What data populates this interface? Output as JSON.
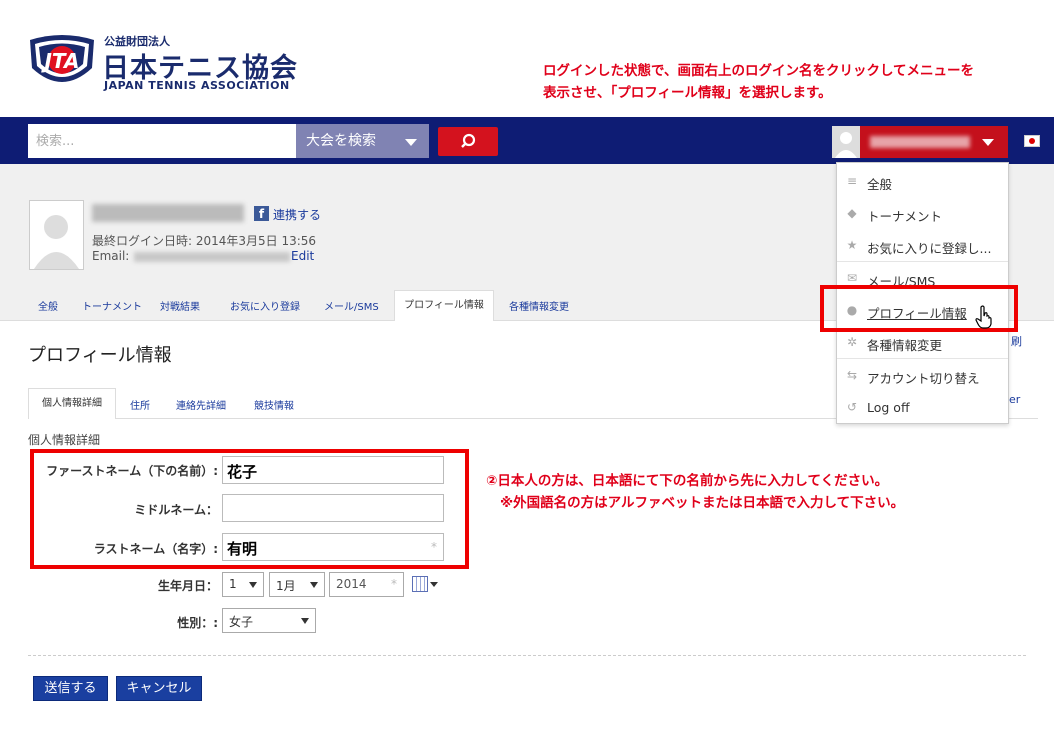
{
  "logo": {
    "emblem_text": "JTA",
    "subtitle": "公益財団法人",
    "main": "日本テニス協会",
    "english": "JAPAN TENNIS ASSOCIATION"
  },
  "instructions": {
    "note1_line1": "ログインした状態で、画面右上のログイン名をクリックしてメニューを",
    "note1_line2": "表示させ、「プロフィール情報」を選択します。",
    "note2_line1": "②日本人の方は、日本語にて下の名前から先に入力してください。",
    "note2_line2": "※外国語名の方はアルファベットまたは日本語で入力して下さい。"
  },
  "nav": {
    "search_placeholder": "検索...",
    "search_type": "大会を検索",
    "search_icon": "search-icon"
  },
  "profile": {
    "facebook_link": "連携する",
    "last_login": "最終ログイン日時: 2014年3月5日  13:56",
    "email_label": "Email:",
    "email_edit": "Edit"
  },
  "main_tabs": [
    "全般",
    "トーナメント",
    "対戦結果",
    "お気に入り登録",
    "メール/SMS",
    "プロフィール情報",
    "各種情報変更"
  ],
  "page_title": "プロフィール情報",
  "sub_tabs": [
    "個人情報詳細",
    "住所",
    "連絡先詳細",
    "競技情報"
  ],
  "section_label": "個人情報詳細",
  "form": {
    "first_name_label": "ファーストネーム（下の名前）:",
    "first_name_value": "花子",
    "middle_name_label": "ミドルネーム：",
    "middle_name_value": "",
    "last_name_label": "ラストネーム（名字）:",
    "last_name_value": "有明",
    "required_mark": "*",
    "birthdate_label": "生年月日：",
    "birth_day": "1",
    "birth_month": "1月",
    "birth_year": "2014",
    "gender_label": "性別：:",
    "gender_value": "女子",
    "submit": "送信する",
    "cancel": "キャンセル"
  },
  "dropdown": {
    "items": [
      {
        "label": "全般",
        "icon": "list-icon"
      },
      {
        "label": "トーナメント",
        "icon": "shield-icon"
      },
      {
        "label": "お気に入りに登録し...",
        "icon": "star-icon"
      },
      {
        "label": "メール/SMS",
        "icon": "mail-icon"
      },
      {
        "label": "プロフィール情報",
        "icon": "user-icon"
      },
      {
        "label": "各種情報変更",
        "icon": "gear-icon"
      },
      {
        "label": "アカウント切り替え",
        "icon": "switch-icon"
      },
      {
        "label": "Log off",
        "icon": "logoff-icon"
      }
    ]
  },
  "side_fragments": {
    "top": "刷",
    "bottom": "er"
  },
  "colors": {
    "navy": "#0e1c74",
    "red": "#d4121e",
    "link": "#1a3a9c",
    "annotation": "#e0001a"
  }
}
